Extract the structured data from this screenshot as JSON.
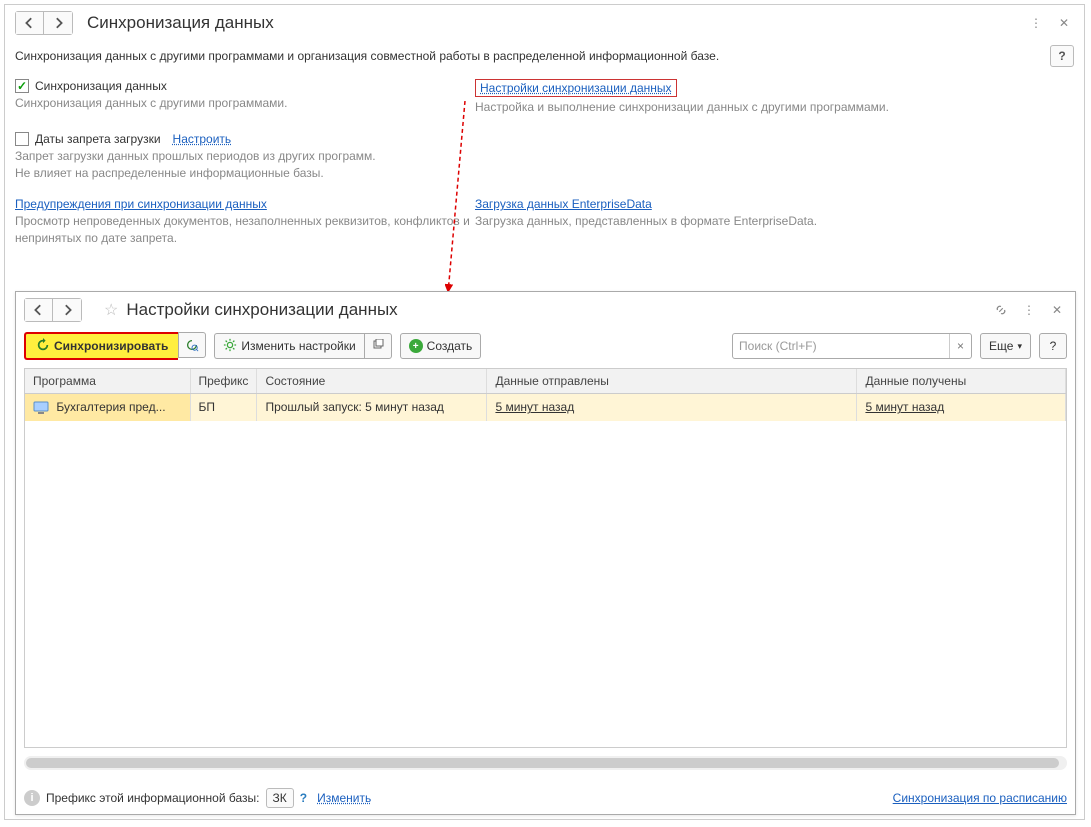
{
  "outer": {
    "title": "Синхронизация данных",
    "description": "Синхронизация данных с другими программами и организация совместной работы в распределенной информационной базе.",
    "sync_checkbox_label": "Синхронизация данных",
    "sync_hint": "Синхронизация данных с другими программами.",
    "settings_link": "Настройки синхронизации данных",
    "settings_hint": "Настройка и выполнение синхронизации данных с другими программами.",
    "ban_checkbox_label": "Даты запрета загрузки",
    "ban_configure": "Настроить",
    "ban_hint": "Запрет загрузки данных прошлых периодов из других программ.\nНе влияет на распределенные информационные базы.",
    "warnings_link": "Предупреждения при синхронизации данных",
    "warnings_hint": "Просмотр непроведенных документов, незаполненных реквизитов, конфликтов и непринятых по дате запрета.",
    "enterprise_link": "Загрузка данных EnterpriseData",
    "enterprise_hint": "Загрузка данных, представленных в формате EnterpriseData."
  },
  "inner": {
    "title": "Настройки синхронизации данных",
    "toolbar": {
      "sync": "Синхронизировать",
      "change": "Изменить настройки",
      "create": "Создать",
      "search_placeholder": "Поиск (Ctrl+F)",
      "more": "Еще",
      "help": "?"
    },
    "table": {
      "headers": [
        "Программа",
        "Префикс",
        "Состояние",
        "Данные отправлены",
        "Данные получены"
      ],
      "rows": [
        {
          "program": "Бухгалтерия пред...",
          "prefix": "БП",
          "state": "Прошлый запуск: 5 минут назад",
          "sent": "5 минут назад",
          "received": "5 минут назад"
        }
      ]
    },
    "footer": {
      "label": "Префикс этой информационной базы:",
      "prefix": "ЗК",
      "change": "Изменить",
      "schedule": "Синхронизация по расписанию"
    }
  }
}
